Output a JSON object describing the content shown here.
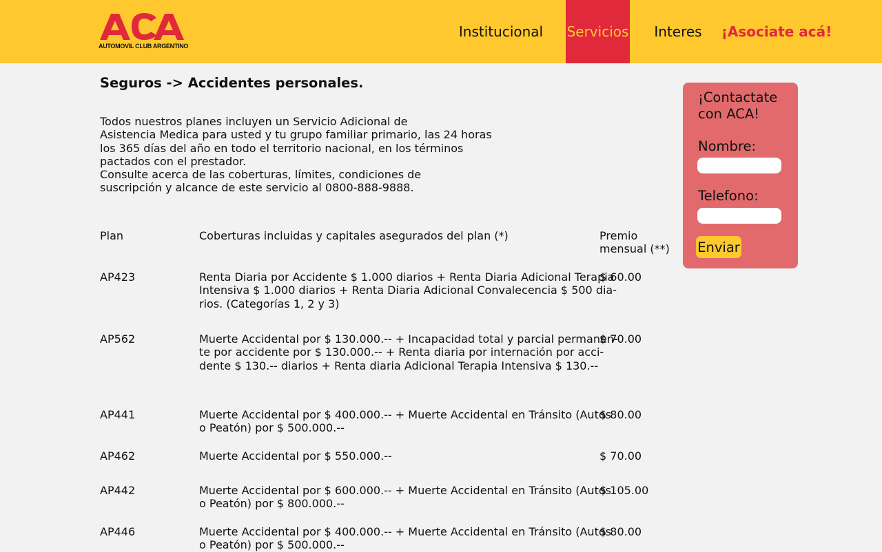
{
  "header": {
    "logo_text": "ACA",
    "logo_subtitle": "AUTOMOVIL CLUB ARGENTINO",
    "nav": {
      "institucional": "Institucional",
      "servicios": "Servicios",
      "interes": "Interes",
      "asociate": "¡Asociate acá!"
    },
    "active_nav": "Servicios"
  },
  "main": {
    "title": "Seguros -> Accidentes personales.",
    "intro_lines": [
      "Todos nuestros planes  incluyen un Servicio Adicional de",
      "Asistencia Medica para usted y tu grupo familiar primario, las 24 horas",
      "los 365 días del año en todo el territorio nacional, en los términos",
      "pactados con el prestador.",
      "Consulte acerca de las coberturas, límites, condiciones de",
      "suscripción y alcance de este servicio al 0800-888-9888."
    ],
    "table": {
      "headers": {
        "plan": "Plan",
        "coverage": "Coberturas incluidas y capitales asegurados del plan (*)",
        "premium_line1": "Premio",
        "premium_line2": "mensual (**)"
      },
      "rows": [
        {
          "plan": "AP423",
          "coverage_lines": [
            "Renta Diaria por Accidente $ 1.000 diarios + Renta Diaria Adicional Terapia",
            "Intensiva $ 1.000 diarios + Renta Diaria Adicional Convalecencia $ 500 dia-",
            "rios. (Categorías 1, 2 y 3)"
          ],
          "premium": "$ 60.00"
        },
        {
          "plan": "AP562",
          "coverage_lines": [
            "Muerte Accidental por $ 130.000.-- + Incapacidad total y parcial permanen-",
            "te por accidente por $ 130.000.-- + Renta diaria por internación por acci-",
            "dente $ 130.-- diarios + Renta diaria Adicional Terapia Intensiva $ 130.--"
          ],
          "premium": "$ 70.00"
        },
        {
          "plan": "AP441",
          "coverage_lines": [
            "Muerte Accidental por $ 400.000.-- + Muerte Accidental en Tránsito (Autos",
            "o Peatón) por $ 500.000.--"
          ],
          "premium": "$ 80.00"
        },
        {
          "plan": "AP462",
          "coverage_lines": [
            "Muerte Accidental por $ 550.000.--"
          ],
          "premium": "$ 70.00"
        },
        {
          "plan": "AP442",
          "coverage_lines": [
            "Muerte Accidental por $ 600.000.-- + Muerte Accidental en Tránsito (Autos",
            "o Peatón) por $ 800.000.--"
          ],
          "premium": "$ 105.00"
        },
        {
          "plan": "AP446",
          "coverage_lines": [
            "Muerte Accidental por $ 400.000.-- + Muerte Accidental en Tránsito (Autos",
            "o Peatón) por $ 500.000.--"
          ],
          "premium": "$ 80.00"
        }
      ]
    }
  },
  "contact": {
    "title_line1": "¡Contactate",
    "title_line2": "con ACA!",
    "name_label": "Nombre:",
    "name_value": "",
    "phone_label": "Telefono:",
    "phone_value": "",
    "submit_label": "Enviar"
  },
  "colors": {
    "header_bg": "#ffc82e",
    "brand_red": "#e0293a",
    "contact_bg": "#e26a6c",
    "page_bg": "#f2f2f2"
  },
  "icons": {
    "logo": "aca-logo"
  }
}
